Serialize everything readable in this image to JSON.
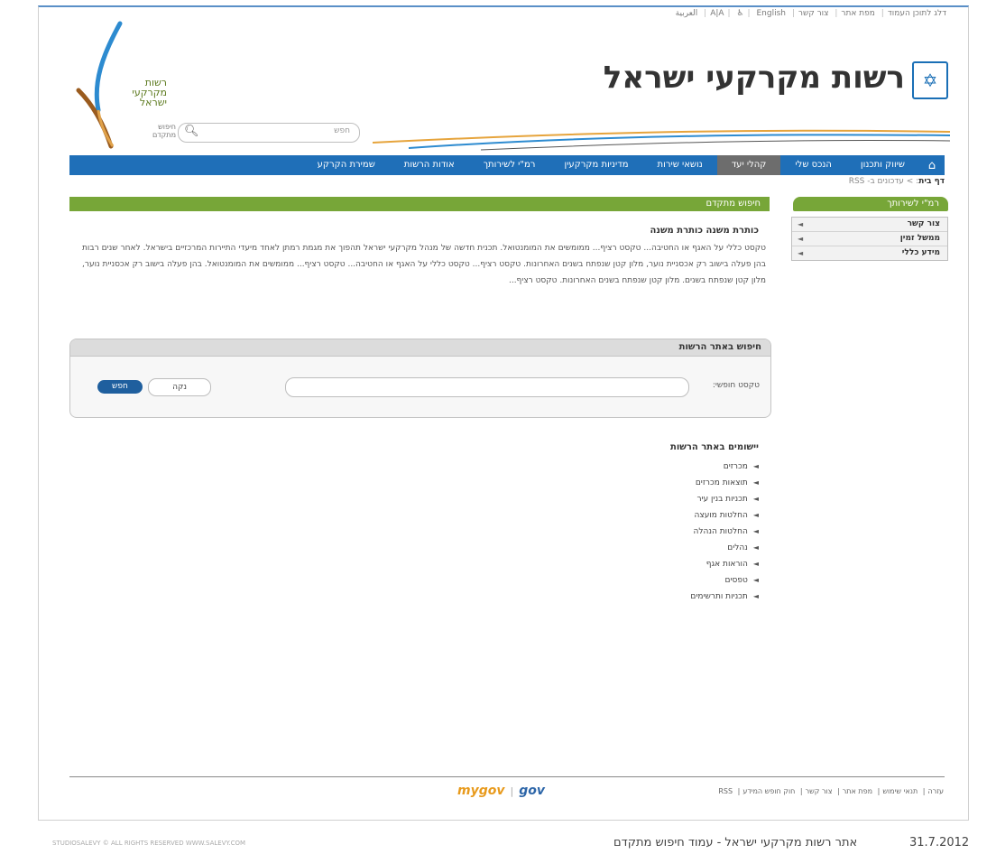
{
  "utility_bar": {
    "links": [
      "דלג לתוכן העמוד",
      "מפת אתר",
      "צור קשר",
      "A|A",
      "♿",
      "English",
      "العربية"
    ]
  },
  "header": {
    "site_title": "רשות מקרקעי ישראל",
    "logo_lines": [
      "רשות",
      "מקרקעי",
      "ישראל"
    ],
    "search_placeholder": "חפש",
    "advanced_search_link": "חיפוש מתקדם"
  },
  "nav": {
    "items": [
      {
        "label": "שיווק ותכנון",
        "active": false
      },
      {
        "label": "הנכס שלי",
        "active": false
      },
      {
        "label": "קהלי יעד",
        "active": true
      },
      {
        "label": "נושאי שירות",
        "active": false
      },
      {
        "label": "מדיניות מקרקעין",
        "active": false
      },
      {
        "label": "רמ\"י לשירותך",
        "active": false
      },
      {
        "label": "אודות הרשות",
        "active": false
      },
      {
        "label": "שמירת הקרקע",
        "active": false
      }
    ]
  },
  "breadcrumb": {
    "label": "דף בית",
    "trail": "> עדכונים ב- RSS"
  },
  "sidebar": {
    "title": "רמ\"י לשירותך",
    "items": [
      "צור קשר",
      "ממשל זמין",
      "מידע כללי"
    ]
  },
  "main": {
    "title": "חיפוש מתקדם",
    "subtitle": "כותרת משנה כותרת משנה",
    "paragraph": "טקסט כללי על האגף או החטיבה... טקסט רציף... ממומשים את המומנטואל. תכנית חדשה של מנהל מקרקעי ישראל תהפוך את מגמת רמתן לאחד מיעדי התיירות המרכזיים בישראל. לאחר שנים רבות בהן פעלה בישוב רק אכסניית נוער, מלון קטן שנפתח בשנים האחרונות. טקסט רציף... טקסט כללי על האגף או החטיבה... טקסט רציף... ממומשים את המומנטואל. בהן פעלה בישוב רק אכסניית נוער, מלון קטן שנפתח בשנים. מלון קטן שנפתח בשנים האחרונות. טקסט רציף..."
  },
  "search_panel": {
    "title": "חיפוש באתר הרשות",
    "field_label": "טקסט חופשי:",
    "clear_button": "נקה",
    "search_button": "חפש"
  },
  "apps": {
    "title": "יישומים באתר הרשות",
    "items": [
      "מכרזים",
      "תוצאות מכרזים",
      "תכניות בנין עיר",
      "החלטות מועצה",
      "החלטות הנהלה",
      "נהלים",
      "הוראות אגף",
      "טפסים",
      "תכניות ותרשימים"
    ]
  },
  "footer": {
    "links": [
      "עזרה",
      "תנאי שימוש",
      "מפת אתר",
      "צור קשר",
      "חוק חופש המידע",
      "RSS"
    ],
    "gov_logos": [
      "mygov",
      "gov"
    ],
    "caption": "אתר רשות מקרקעי ישראל - עמוד חיפוש מתקדם",
    "date": "31.7.2012",
    "copyright": "STUDIOSALEVY © ALL RIGHTS RESERVED WWW.SALEVY.COM"
  },
  "colors": {
    "nav_blue": "#1f6fb8",
    "accent_green": "#77a638",
    "active_gray": "#6d6d6d",
    "button_blue": "#1f5f9e"
  }
}
